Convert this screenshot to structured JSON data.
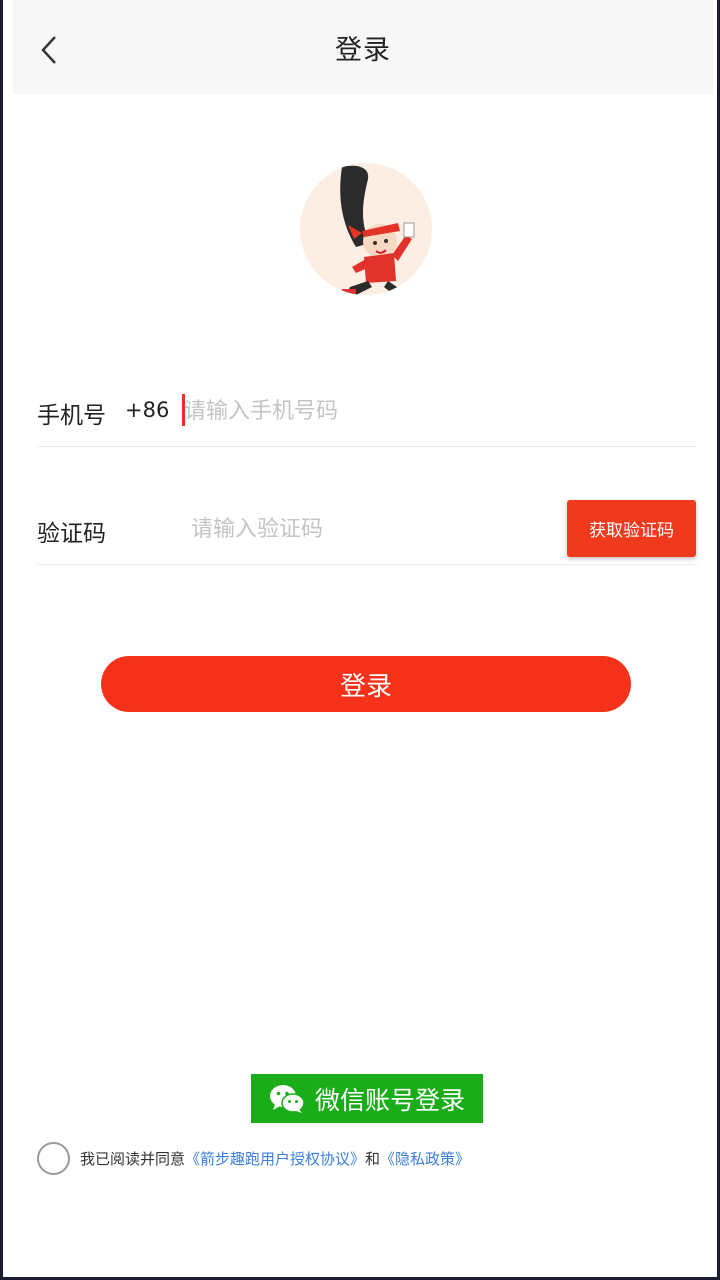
{
  "header": {
    "title": "登录"
  },
  "phone": {
    "label": "手机号",
    "prefix": "+86",
    "placeholder": "请输入手机号码"
  },
  "code": {
    "label": "验证码",
    "placeholder": "请输入验证码",
    "get_code_label": "获取验证码"
  },
  "login_button": "登录",
  "wechat": {
    "label": "微信账号登录"
  },
  "agreement": {
    "prefix": "我已阅读并同意",
    "user_agreement": "《箭步趣跑用户授权协议》",
    "and": "和",
    "privacy": "《隐私政策》"
  },
  "colors": {
    "accent": "#f53219",
    "wechat": "#1aad19",
    "link": "#3a7fe0"
  }
}
